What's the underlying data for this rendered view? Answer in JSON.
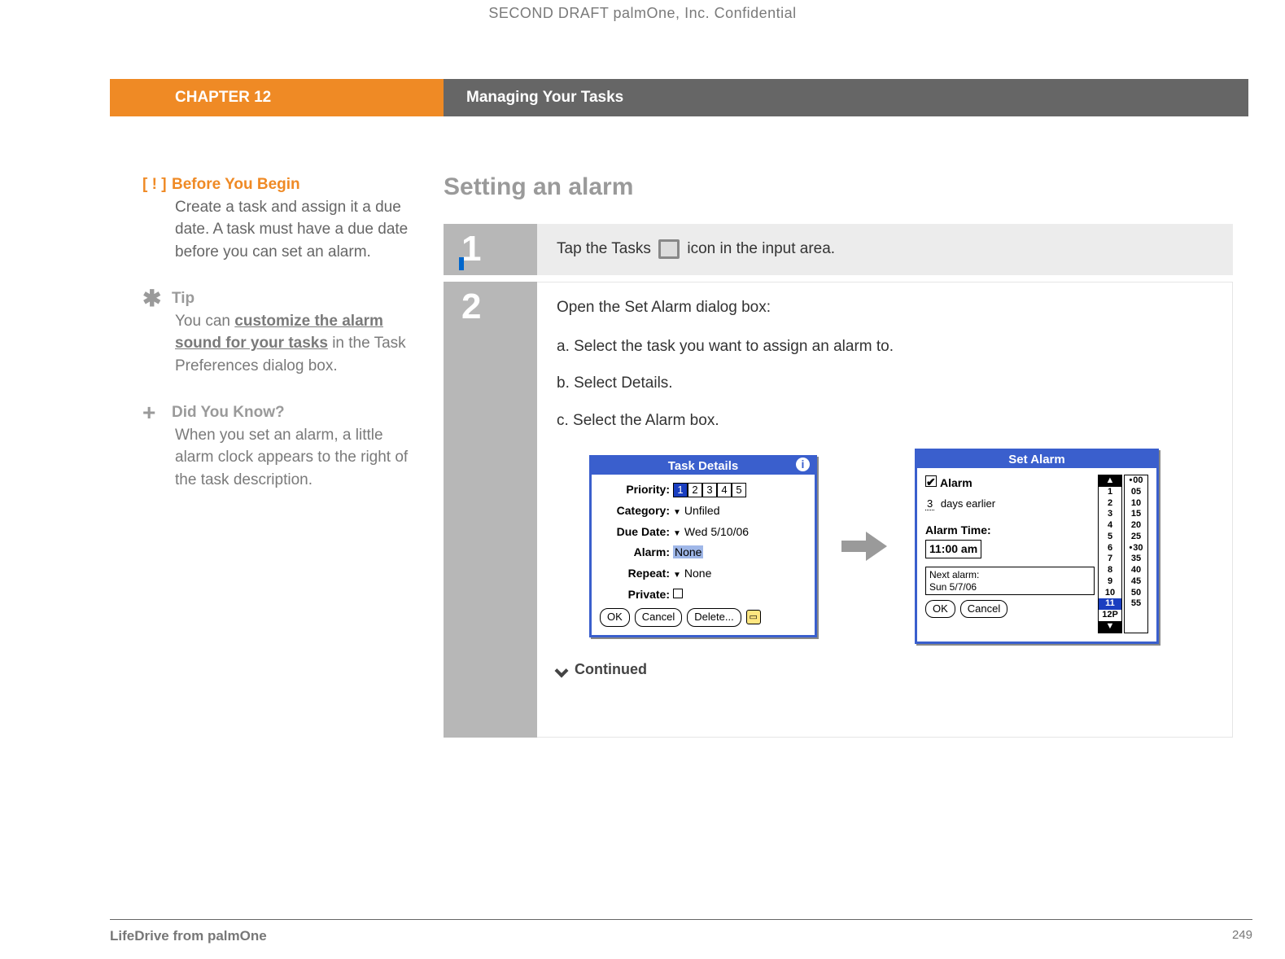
{
  "confidential": "SECOND DRAFT palmOne, Inc.  Confidential",
  "header": {
    "chapter": "CHAPTER 12",
    "title": "Managing Your Tasks"
  },
  "sidebar": {
    "before": {
      "icon": "[ ! ]",
      "title": "Before You Begin",
      "body": "Create a task and assign it a due date. A task must have a due date before you can set an alarm."
    },
    "tip": {
      "icon": "✱",
      "title": "Tip",
      "pre": "You can ",
      "link": "customize the alarm sound for your tasks",
      "post": " in the Task Preferences dialog box."
    },
    "dyk": {
      "icon": "+",
      "title": "Did You Know?",
      "body": "When you set an alarm, a little alarm clock appears to the right of the task description."
    }
  },
  "main": {
    "section_title": "Setting an alarm",
    "step1": {
      "num": "1",
      "pre": "Tap the Tasks ",
      "post": " icon in the input area."
    },
    "step2": {
      "num": "2",
      "intro": "Open the Set Alarm dialog box:",
      "a": "a.  Select the task you want to assign an alarm to.",
      "b": "b.  Select Details.",
      "c": "c.  Select the Alarm box.",
      "continued": "Continued"
    },
    "task_details": {
      "title": "Task Details",
      "priority_label": "Priority:",
      "priority_options": [
        "1",
        "2",
        "3",
        "4",
        "5"
      ],
      "priority_selected": "1",
      "category_label": "Category:",
      "category_value": "Unfiled",
      "due_label": "Due Date:",
      "due_value": "Wed 5/10/06",
      "alarm_label": "Alarm:",
      "alarm_value": "None",
      "repeat_label": "Repeat:",
      "repeat_value": "None",
      "private_label": "Private:",
      "btn_ok": "OK",
      "btn_cancel": "Cancel",
      "btn_delete": "Delete..."
    },
    "set_alarm": {
      "title": "Set Alarm",
      "alarm_chk_label": "Alarm",
      "days_value": "3",
      "days_label": "days earlier",
      "time_label": "Alarm Time:",
      "time_value": "11:00 am",
      "next_label": "Next alarm:",
      "next_value": "Sun 5/7/06",
      "btn_ok": "OK",
      "btn_cancel": "Cancel",
      "hours": [
        "1",
        "2",
        "3",
        "4",
        "5",
        "6",
        "7",
        "8",
        "9",
        "10",
        "11",
        "12P"
      ],
      "hour_selected": "11",
      "minutes": [
        "00",
        "05",
        "10",
        "15",
        "20",
        "25",
        "30",
        "35",
        "40",
        "45",
        "50",
        "55"
      ],
      "minute_marks": [
        "00",
        "30"
      ]
    }
  },
  "footer": {
    "left": "LifeDrive from palmOne",
    "page": "249"
  }
}
